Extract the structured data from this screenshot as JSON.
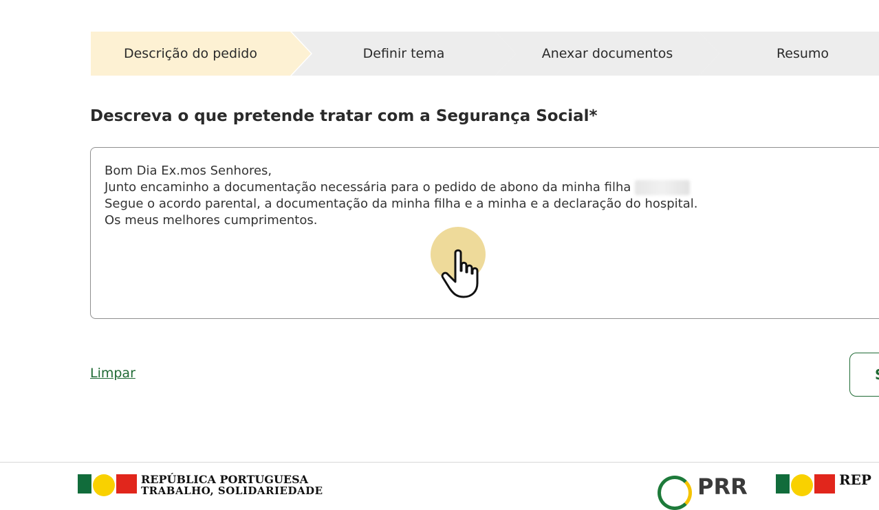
{
  "steps": [
    {
      "label": "Descrição do pedido",
      "active": true
    },
    {
      "label": "Definir tema",
      "active": false
    },
    {
      "label": "Anexar documentos",
      "active": false
    },
    {
      "label": "Resumo",
      "active": false
    }
  ],
  "form": {
    "question": "Descreva o que pretende tratar com a Segurança Social*",
    "lines": [
      "Bom Dia Ex.mos Senhores,",
      "Junto encaminho a documentação necessária para o pedido de abono da minha filha",
      "Segue o acordo parental, a documentação da minha filha e a minha e a declaração do hospital.",
      "Os meus melhores cumprimentos."
    ]
  },
  "actions": {
    "clear_label": "Limpar",
    "next_label": "S"
  },
  "footer": {
    "logo_line1": "REPÚBLICA PORTUGUESA",
    "logo_line2": "TRABALHO, SOLIDARIEDADE",
    "prr_label": "PRR",
    "logo2_text": "REP"
  },
  "colors": {
    "active_step": "#fdf1d3",
    "inactive_step": "#ededed",
    "brand_green": "#1f6a34"
  }
}
